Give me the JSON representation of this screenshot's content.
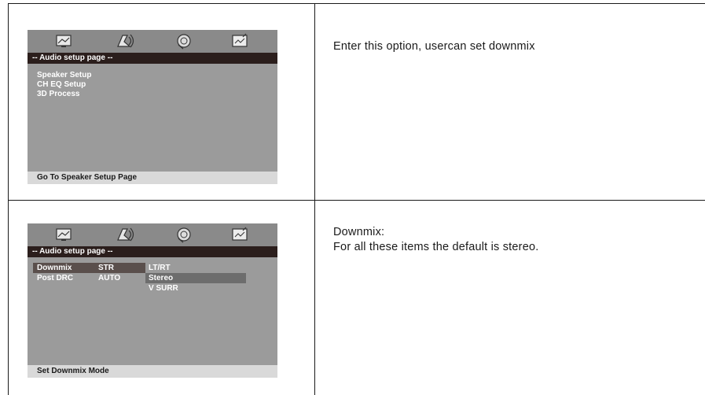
{
  "rows": [
    {
      "osd": {
        "title": "-- Audio setup page --",
        "items": [
          "Speaker Setup",
          "CH EQ Setup",
          "3D Process"
        ],
        "footer": "Go To Speaker Setup Page"
      },
      "description": "Enter  this option, usercan set downmix"
    },
    {
      "osd": {
        "title": "-- Audio setup page --",
        "settings": [
          {
            "label": "Downmix",
            "value": "STR"
          },
          {
            "label": "Post DRC",
            "value": "AUTO"
          }
        ],
        "options": [
          "LT/RT",
          "Stereo",
          "V SURR"
        ],
        "footer": "Set Downmix Mode"
      },
      "description_line1": "Downmix:",
      "description_line2": "For all these items  the default is stereo."
    }
  ],
  "icons": [
    "tv-screen-icon",
    "speaker-audio-icon",
    "disc-tape-icon",
    "preferences-icon"
  ]
}
